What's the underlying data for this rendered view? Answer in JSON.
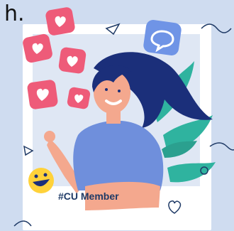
{
  "page": {
    "cropped_heading": "h.",
    "member_tag": "#CU Member"
  },
  "colors": {
    "background": "#cfdcf0",
    "frame": "#ffffff",
    "frame_inner": "#dfe7f4",
    "heart_bubble": "#ee5b79",
    "chat_bubble": "#6f94e6",
    "hair": "#1b2f7a",
    "shirt": "#6f8fdc",
    "skin": "#f4a88e",
    "leaves": "#2fb39f",
    "emoji": "#ffd23a",
    "outline_accent": "#1f3a66"
  },
  "icons": [
    "heart-icon",
    "chat-bubble-icon",
    "smiley-emoji-icon",
    "triangle-outline-icon",
    "circle-outline-icon",
    "heart-outline-icon"
  ]
}
